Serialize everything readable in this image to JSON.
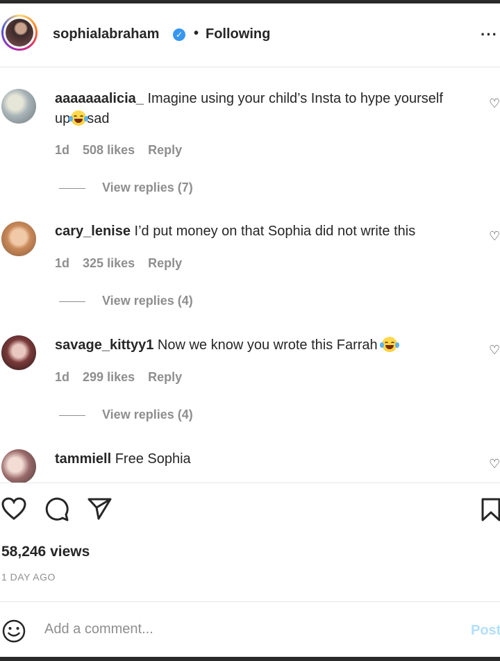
{
  "header": {
    "username": "sophialabraham",
    "separator": "•",
    "following_label": "Following",
    "more_label": "···"
  },
  "comments": [
    {
      "username": "aaaaaaalicia_",
      "text_before": "Imagine using your child’s Insta to hype yourself up",
      "emoji": "joy",
      "text_after": "sad",
      "time": "1d",
      "likes": "508 likes",
      "reply": "Reply",
      "view_replies": "View replies (7)"
    },
    {
      "username": "cary_lenise",
      "text_before": "I’d put money on that Sophia did not write this",
      "time": "1d",
      "likes": "325 likes",
      "reply": "Reply",
      "view_replies": "View replies (4)"
    },
    {
      "username": "savage_kittyy1",
      "text_before": "Now we know you wrote this Farrah",
      "emoji": "joy",
      "time": "1d",
      "likes": "299 likes",
      "reply": "Reply",
      "view_replies": "View replies (4)"
    },
    {
      "username": "tammiell",
      "text_before": "Free Sophia"
    }
  ],
  "actions": {
    "views": "58,246 views",
    "posted": "1 DAY AGO",
    "icons": [
      "heart-icon",
      "comment-icon",
      "share-icon",
      "bookmark-icon"
    ]
  },
  "add_comment": {
    "placeholder": "Add a comment...",
    "post_label": "Post"
  },
  "colors": {
    "verified": "#3897f0",
    "muted": "#8e8e8e",
    "post_disabled": "#b2dffc"
  }
}
